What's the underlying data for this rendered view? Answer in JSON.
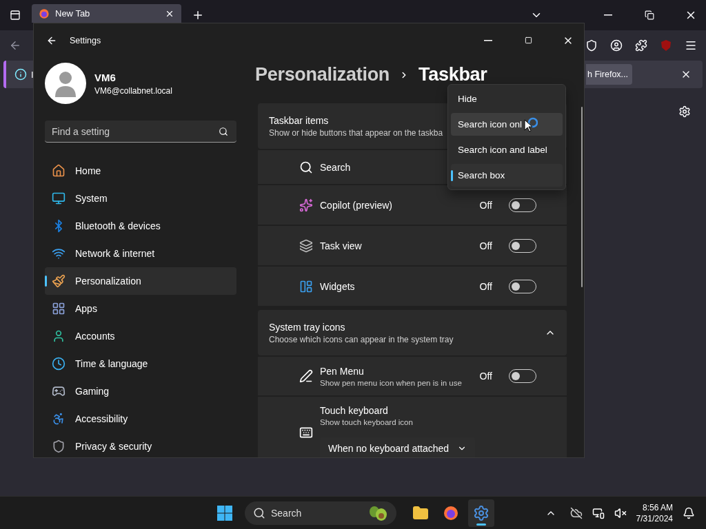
{
  "browser": {
    "tabs": [
      {
        "title": "New Tab",
        "selected": true
      }
    ],
    "notification": {
      "text": "I",
      "button": "h Firefox..."
    }
  },
  "settings": {
    "title": "Settings",
    "user": {
      "name": "VM6",
      "email": "VM6@collabnet.local"
    },
    "search": {
      "placeholder": "Find a setting"
    },
    "nav": [
      {
        "label": "Home",
        "selected": false
      },
      {
        "label": "System",
        "selected": false
      },
      {
        "label": "Bluetooth & devices",
        "selected": false
      },
      {
        "label": "Network & internet",
        "selected": false
      },
      {
        "label": "Personalization",
        "selected": true
      },
      {
        "label": "Apps",
        "selected": false
      },
      {
        "label": "Accounts",
        "selected": false
      },
      {
        "label": "Time & language",
        "selected": false
      },
      {
        "label": "Gaming",
        "selected": false
      },
      {
        "label": "Accessibility",
        "selected": false
      },
      {
        "label": "Privacy & security",
        "selected": false
      }
    ],
    "breadcrumb": {
      "parent": "Personalization",
      "current": "Taskbar"
    },
    "sections": [
      {
        "title": "Taskbar items",
        "subtitle": "Show or hide buttons that appear on the taskba",
        "rows": [
          {
            "kind": "plain",
            "label": "Search"
          },
          {
            "kind": "toggle",
            "label": "Copilot (preview)",
            "state": "Off",
            "on": false
          },
          {
            "kind": "toggle",
            "label": "Task view",
            "state": "Off",
            "on": false
          },
          {
            "kind": "toggle",
            "label": "Widgets",
            "state": "Off",
            "on": false
          }
        ]
      },
      {
        "title": "System tray icons",
        "subtitle": "Choose which icons can appear in the system tray",
        "expanded": true,
        "rows": [
          {
            "kind": "toggle",
            "label": "Pen Menu",
            "description": "Show pen menu icon when pen is in use",
            "state": "Off",
            "on": false
          },
          {
            "kind": "select",
            "label": "Touch keyboard",
            "description": "Show touch keyboard icon",
            "value": "When no keyboard attached"
          }
        ]
      }
    ],
    "menu": {
      "items": [
        {
          "label": "Hide",
          "selected": false,
          "hovered": false
        },
        {
          "label": "Search icon onl",
          "selected": false,
          "hovered": true
        },
        {
          "label": "Search icon and label",
          "selected": false,
          "hovered": false
        },
        {
          "label": "Search box",
          "selected": true,
          "hovered": false
        }
      ]
    }
  },
  "taskbar": {
    "search": "Search",
    "apps": [
      {
        "active": false
      },
      {
        "active": false
      },
      {
        "active": true
      }
    ],
    "time": "8:56 AM",
    "date": "7/31/2024"
  }
}
